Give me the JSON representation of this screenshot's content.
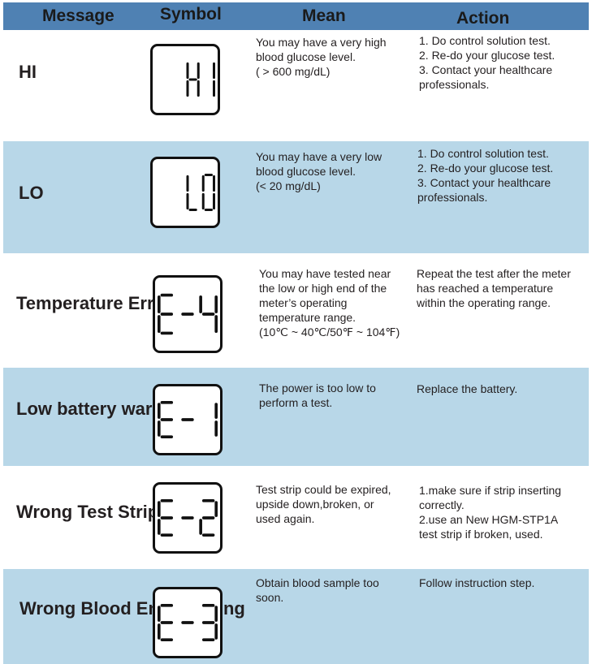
{
  "colors": {
    "header_bg": "#4f81b3",
    "row_shade": "#b8d7e8",
    "text": "#231f20"
  },
  "header": {
    "message": "Message",
    "symbol": "Symbol",
    "mean": "Mean",
    "action": "Action"
  },
  "rows": [
    {
      "message": "HI",
      "symbol": "HI",
      "symbol_display": [
        " ",
        " ",
        "H",
        "1"
      ],
      "mean": "You may have a very high\nblood glucose level.\n( > 600 mg/dL)",
      "action": "1. Do control solution test.\n2. Re-do your glucose test.\n3. Contact your healthcare\nprofessionals.",
      "shaded": false
    },
    {
      "message": "LO",
      "symbol": "LO",
      "symbol_display": [
        " ",
        " ",
        "L",
        "0"
      ],
      "mean": "You may have a very low\nblood glucose level.\n(< 20 mg/dL)",
      "action": "1. Do control solution test.\n2. Re-do your glucose test.\n3. Contact your healthcare\nprofessionals.",
      "shaded": true
    },
    {
      "message": "Temperature\nError",
      "symbol": "E-4",
      "symbol_display": [
        "E",
        "-",
        "4"
      ],
      "mean": "You may have tested near\nthe low or high end of the\nmeter’s operating\ntemperature range.\n(10℃ ~ 40℃/50℉ ~ 104℉)",
      "action": "Repeat the test after the meter\nhas reached a temperature\nwithin the operating range.",
      "shaded": false
    },
    {
      "message": "Low battery\nwarning",
      "symbol": "E-1",
      "symbol_display": [
        "E",
        "-",
        "1"
      ],
      "mean": "The power is too low to\nperform a test.",
      "action": "Replace the battery.",
      "shaded": true
    },
    {
      "message": "Wrong Test\nStrip",
      "symbol": "E-2",
      "symbol_display": [
        "E",
        "-",
        "2"
      ],
      "mean": "Test strip could be expired,\nupside down,broken, or\nused again.",
      "action": "1.make sure if strip inserting\ncorrectly.\n2.use an New HGM-STP1A\ntest strip if broken, used.",
      "shaded": false
    },
    {
      "message": "Wrong Blood\nEnter Timing",
      "symbol": "E-3",
      "symbol_display": [
        "E",
        "-",
        "3"
      ],
      "mean": "Obtain blood sample too\nsoon.",
      "action": "Follow instruction step.",
      "shaded": true
    }
  ]
}
